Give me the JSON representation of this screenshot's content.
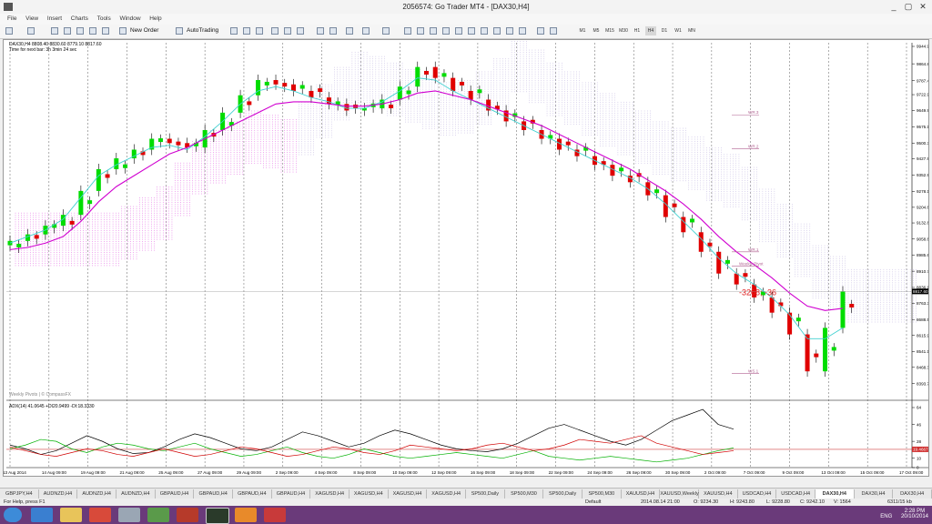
{
  "window": {
    "title": "2056574: Go Trader MT4 - [DAX30,H4]",
    "minimize": "_",
    "restore": "▢",
    "close": "✕"
  },
  "menu": [
    "File",
    "View",
    "Insert",
    "Charts",
    "Tools",
    "Window",
    "Help"
  ],
  "toolbar": {
    "new_order": "New Order",
    "autotrading": "AutoTrading",
    "timeframes": [
      "M1",
      "M5",
      "M15",
      "M30",
      "H1",
      "H4",
      "D1",
      "W1",
      "MN"
    ]
  },
  "chart": {
    "header": "DAX30,H4  8808.40 8830.60 8779.10 8817.60",
    "timer": "Time for next bar: 3h 3min 24 sec",
    "watermark": "Weekly Pivots | © CompassFX",
    "annotation": "-3208; -36",
    "weekly_pivot_label": "Weekly Pivot",
    "current_price_label": "8817.60",
    "pivot_labels": [
      "WR.3",
      "WR.2",
      "WR.1",
      "WS.1"
    ],
    "adx_header": "ADX(14) 41.0645 +DI20.9499 -DI:18.3330",
    "adx_level_label": "19.4667",
    "colors": {
      "bull": "#00dd00",
      "bear": "#e00000",
      "fast": "#40d0d0",
      "slow": "#d000d0",
      "cloud": "#9a88cc",
      "adx": "#000000",
      "plus_di": "#00b000",
      "minus_di": "#d00000",
      "pivot": "#b06090"
    }
  },
  "chart_data": [
    {
      "type": "candlestick",
      "symbol": "DAX30",
      "timeframe": "H4",
      "ylim": [
        8321.1,
        9944.9
      ],
      "y_ticks": [
        9944.9,
        9864.8,
        9787.4,
        9722.9,
        9649.9,
        9575.1,
        9500.3,
        9427.9,
        9352.9,
        9278.1,
        9204.6,
        9132.8,
        9058.6,
        8985.6,
        8910.7,
        8836.1,
        8763.3,
        8688.5,
        8615.9,
        8541.1,
        8468.3,
        8393.7,
        8321.1
      ],
      "x_tick_labels": [
        "13 Aug 2014",
        "14 Aug 09:00",
        "19 Aug 09:00",
        "21 Aug 09:00",
        "25 Aug 09:00",
        "27 Aug 09:00",
        "29 Aug 09:00",
        "2 Sep 09:00",
        "4 Sep 09:00",
        "8 Sep 09:00",
        "10 Sep 09:00",
        "12 Sep 09:00",
        "16 Sep 09:00",
        "18 Sep 09:00",
        "22 Sep 09:00",
        "24 Sep 09:00",
        "26 Sep 09:00",
        "30 Sep 09:00",
        "2 Oct 09:00",
        "7 Oct 09:00",
        "9 Oct 09:00",
        "13 Oct 09:00",
        "15 Oct 09:00",
        "17 Oct 09:00"
      ],
      "close_path": [
        9050,
        9080,
        9120,
        9170,
        9280,
        9380,
        9430,
        9470,
        9520,
        9500,
        9480,
        9560,
        9640,
        9720,
        9790,
        9770,
        9740,
        9710,
        9680,
        9650,
        9660,
        9700,
        9760,
        9850,
        9800,
        9740,
        9700,
        9650,
        9600,
        9560,
        9520,
        9470,
        9440,
        9400,
        9350,
        9320,
        9260,
        9160,
        9090,
        9000,
        8900,
        8850,
        8790,
        8720,
        8620,
        8450,
        8650,
        8817
      ],
      "series": [
        {
          "name": "Tenkan",
          "values": [
            9040,
            9070,
            9100,
            9150,
            9250,
            9350,
            9400,
            9440,
            9480,
            9490,
            9470,
            9530,
            9600,
            9680,
            9740,
            9760,
            9740,
            9710,
            9690,
            9660,
            9660,
            9690,
            9740,
            9800,
            9790,
            9740,
            9700,
            9660,
            9620,
            9580,
            9540,
            9500,
            9460,
            9420,
            9380,
            9340,
            9290,
            9220,
            9140,
            9060,
            8970,
            8900,
            8850,
            8790,
            8710,
            8600,
            8600,
            8650
          ]
        },
        {
          "name": "Kijun",
          "values": [
            9010,
            9020,
            9040,
            9070,
            9140,
            9230,
            9300,
            9350,
            9400,
            9450,
            9480,
            9520,
            9560,
            9600,
            9640,
            9680,
            9690,
            9690,
            9680,
            9670,
            9670,
            9680,
            9700,
            9730,
            9740,
            9720,
            9700,
            9670,
            9640,
            9610,
            9580,
            9540,
            9500,
            9460,
            9420,
            9380,
            9330,
            9280,
            9220,
            9150,
            9070,
            9000,
            8940,
            8880,
            8810,
            8750,
            8730,
            8740
          ]
        }
      ]
    },
    {
      "type": "line",
      "name": "ADX(14)",
      "ylim": [
        0,
        64
      ],
      "y_ticks": [
        64,
        46,
        28,
        19.4667,
        10,
        0
      ],
      "series": [
        {
          "name": "ADX",
          "values": [
            24,
            20,
            14,
            18,
            26,
            34,
            28,
            20,
            15,
            16,
            22,
            30,
            36,
            32,
            26,
            20,
            18,
            22,
            30,
            38,
            34,
            28,
            22,
            26,
            34,
            40,
            36,
            30,
            24,
            20,
            18,
            17,
            20,
            26,
            34,
            42,
            46,
            40,
            34,
            28,
            24,
            30,
            40,
            50,
            56,
            62,
            46,
            41
          ]
        },
        {
          "name": "+DI",
          "values": [
            20,
            24,
            30,
            28,
            20,
            16,
            22,
            26,
            24,
            20,
            18,
            22,
            26,
            20,
            16,
            12,
            14,
            18,
            22,
            16,
            12,
            10,
            14,
            20,
            16,
            12,
            10,
            12,
            14,
            16,
            14,
            12,
            10,
            14,
            18,
            12,
            10,
            8,
            10,
            12,
            10,
            8,
            6,
            8,
            10,
            14,
            18,
            21
          ]
        },
        {
          "name": "-DI",
          "values": [
            22,
            18,
            14,
            12,
            16,
            20,
            18,
            14,
            12,
            16,
            20,
            16,
            12,
            14,
            18,
            22,
            20,
            16,
            12,
            14,
            18,
            22,
            20,
            16,
            14,
            18,
            24,
            22,
            20,
            18,
            20,
            24,
            26,
            22,
            18,
            20,
            24,
            30,
            28,
            26,
            30,
            34,
            26,
            22,
            18,
            14,
            16,
            18
          ]
        }
      ]
    }
  ],
  "tabs": [
    "GBPJPY,H4",
    "AUDNZD,H4",
    "AUDNZD,H4",
    "AUDNZD,H4",
    "GBPAUD,H4",
    "GBPAUD,H4",
    "GBPAUD,H4",
    "GBPAUD,H4",
    "XAGUSD,H4",
    "XAGUSD,H4",
    "XAGUSD,H4",
    "XAGUSD,H4",
    "SP500,Daily",
    "SP500,M30",
    "SP500,Daily",
    "SP500,M30",
    "XAUUSD,H4",
    "XAUUSD,Weekly",
    "XAUUSD,H4",
    "USDCAD,H4",
    "USDCAD,H4",
    "DAX30,H4",
    "DAX30,H4",
    "DAX30,H4"
  ],
  "active_tab": 21,
  "status": {
    "help": "For Help, press F1",
    "profile": "Default",
    "datetime": "2014.08.14 21:00",
    "open": "O: 9234.30",
    "high": "H: 9243.80",
    "low": "L: 9228.80",
    "close": "C: 9242.10",
    "volume": "V: 1564",
    "traffic": "6311/15 kb"
  },
  "tray": {
    "lang": "ENG",
    "time": "2:28 PM",
    "date": "20/10/2014"
  }
}
